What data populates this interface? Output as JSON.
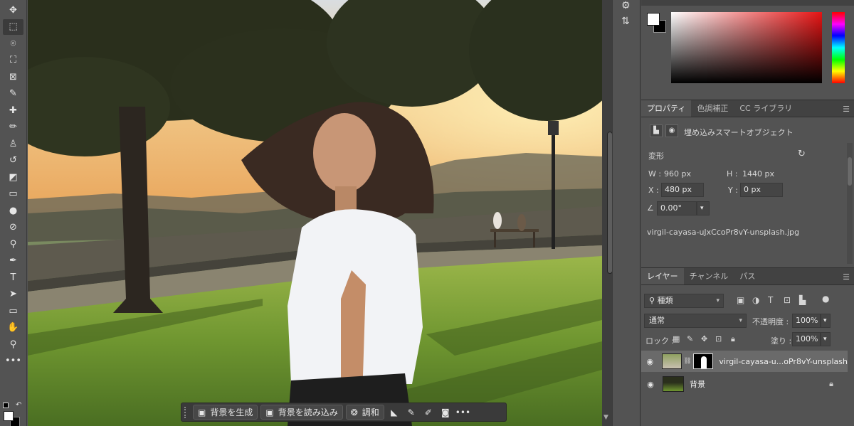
{
  "toolbar": {
    "tools": [
      {
        "name": "move-tool",
        "glyph": "✥"
      },
      {
        "name": "rectangular-marquee-tool",
        "glyph": "⬚",
        "active": true
      },
      {
        "name": "object-selection-tool",
        "glyph": "⌾"
      },
      {
        "name": "crop-tool",
        "glyph": "⛶"
      },
      {
        "name": "frame-tool",
        "glyph": "⊠"
      },
      {
        "name": "eyedropper-tool",
        "glyph": "✎"
      },
      {
        "name": "spot-healing-brush-tool",
        "glyph": "✚"
      },
      {
        "name": "brush-tool",
        "glyph": "✏"
      },
      {
        "name": "clone-stamp-tool",
        "glyph": "♙"
      },
      {
        "name": "history-brush-tool",
        "glyph": "↺"
      },
      {
        "name": "eraser-tool",
        "glyph": "◩"
      },
      {
        "name": "gradient-tool",
        "glyph": "▭"
      },
      {
        "name": "blur-tool",
        "glyph": "●"
      },
      {
        "name": "dodge-tool",
        "glyph": "⊘"
      },
      {
        "name": "burn-tool",
        "glyph": "⚲"
      },
      {
        "name": "pen-tool",
        "glyph": "✒"
      },
      {
        "name": "type-tool",
        "glyph": "T"
      },
      {
        "name": "path-selection-tool",
        "glyph": "➤"
      },
      {
        "name": "rectangle-tool",
        "glyph": "▭"
      },
      {
        "name": "hand-tool",
        "glyph": "✋"
      },
      {
        "name": "zoom-tool",
        "glyph": "⚲"
      },
      {
        "name": "more-tools",
        "glyph": "•••"
      }
    ]
  },
  "taskbar": {
    "generate_background": "背景を生成",
    "import_background": "背景を読み込み",
    "harmonize": "調和",
    "more": "•••"
  },
  "colors": {
    "foreground": "#ffffff",
    "background": "#000000"
  },
  "properties": {
    "tabs": [
      "プロパティ",
      "色調補正",
      "CC ライブラリ"
    ],
    "object_type": "埋め込みスマートオブジェクト",
    "transform_label": "変形",
    "w_label": "W :",
    "w_value": "960 px",
    "h_label": "H :",
    "h_value": "1440 px",
    "x_label": "X :",
    "x_value": "480 px",
    "y_label": "Y :",
    "y_value": "0 px",
    "angle_value": "0.00°",
    "filename": "virgil-cayasa-uJxCcoPr8vY-unsplash.jpg"
  },
  "layers": {
    "tabs": [
      "レイヤー",
      "チャンネル",
      "パス"
    ],
    "filter_label": "種類",
    "blend_mode": "通常",
    "opacity_label": "不透明度 :",
    "opacity_value": "100%",
    "lock_label": "ロック :",
    "fill_label": "塗り :",
    "fill_value": "100%",
    "items": [
      {
        "name": "virgil-cayasa-u...oPr8vY-unsplash",
        "selected": true
      },
      {
        "name": "背景",
        "locked": true
      }
    ]
  }
}
